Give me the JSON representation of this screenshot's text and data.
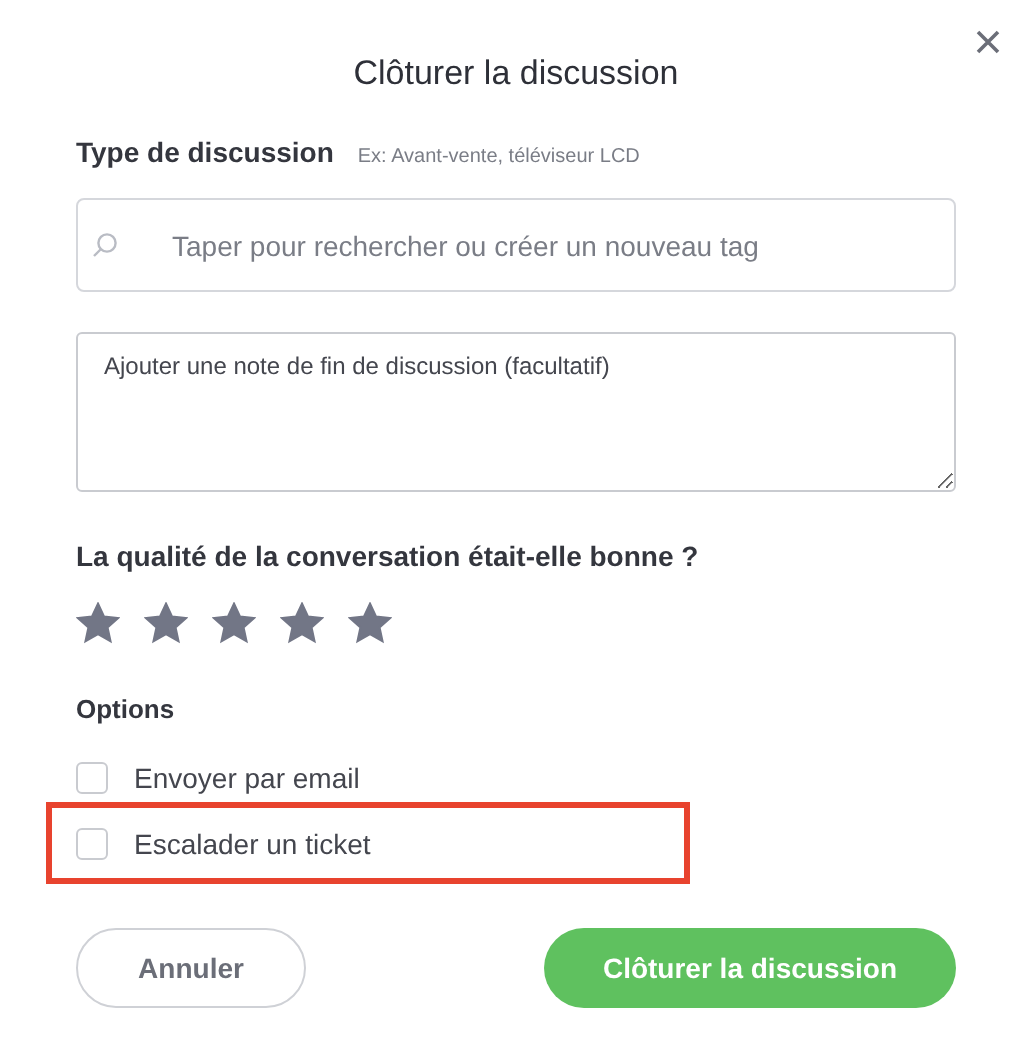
{
  "dialog": {
    "title": "Clôturer la discussion"
  },
  "discussion_type": {
    "label": "Type de discussion",
    "hint": "Ex: Avant-vente, téléviseur LCD",
    "search": {
      "placeholder": "Taper pour rechercher ou créer un nouveau tag"
    }
  },
  "note": {
    "placeholder": "Ajouter une note de fin de discussion (facultatif)"
  },
  "rating": {
    "question": "La qualité de la conversation était-elle bonne ?",
    "stars": 5
  },
  "options": {
    "heading": "Options",
    "items": [
      {
        "label": "Envoyer par email",
        "checked": false,
        "highlighted": false
      },
      {
        "label": "Escalader un ticket",
        "checked": false,
        "highlighted": true
      }
    ]
  },
  "buttons": [
    {
      "label": "Annuler",
      "kind": "secondary"
    },
    {
      "label": "Clôturer la discussion",
      "kind": "primary"
    }
  ]
}
